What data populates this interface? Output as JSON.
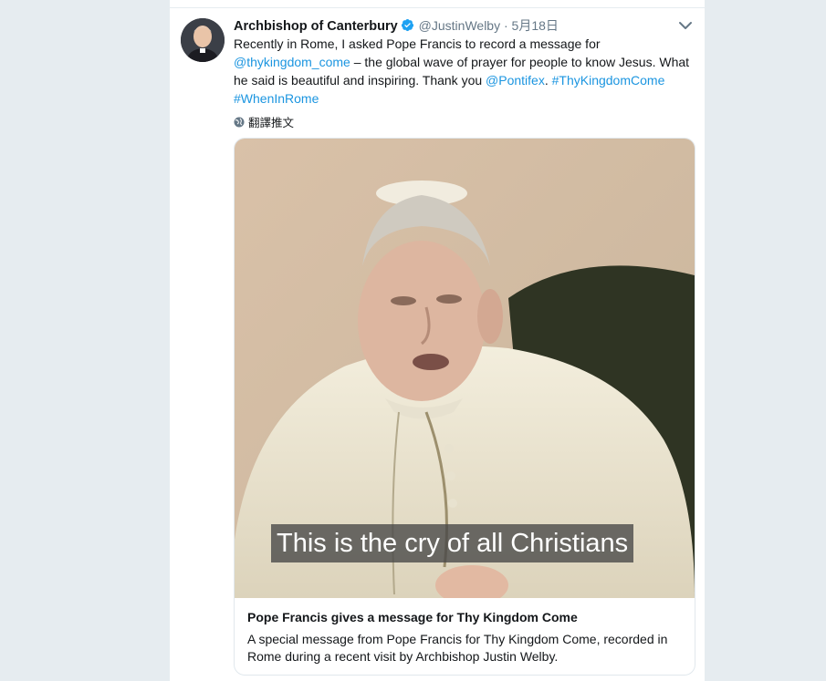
{
  "tweet": {
    "author_name": "Archbishop of Canterbury",
    "handle": "@JustinWelby",
    "separator": "·",
    "date": "5月18日",
    "text_parts": {
      "t1": "Recently in Rome, I asked Pope Francis to record a message for ",
      "mention1": "@thykingdom_come",
      "t2": " – the global wave of prayer for people to know Jesus. What he said is beautiful and inspiring. Thank you ",
      "mention2": "@Pontifex",
      "t3": ". ",
      "hashtag1": "#ThyKingdomCome",
      "t4": " ",
      "hashtag2": "#WhenInRome"
    },
    "translate_label": "翻譯推文"
  },
  "card": {
    "video_caption": "This is the cry of all Christians",
    "title": "Pope Francis gives a message for Thy Kingdom Come",
    "description": "A special message from Pope Francis for Thy Kingdom Come, recorded in Rome during a recent visit by Archbishop Justin Welby."
  },
  "colors": {
    "link": "#1b95e0",
    "verified": "#1da1f2",
    "text": "#14171a",
    "muted": "#657786",
    "background": "#e6ecf0"
  },
  "icons": {
    "verified": "verified-badge-icon",
    "caret": "chevron-down-icon",
    "translate": "globe-icon"
  }
}
